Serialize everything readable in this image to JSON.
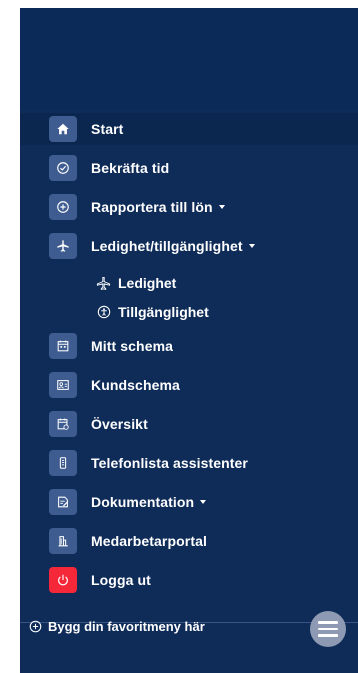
{
  "menu": {
    "items": [
      {
        "label": "Start",
        "icon": "home-icon"
      },
      {
        "label": "Bekräfta tid",
        "icon": "check-circle-icon"
      },
      {
        "label": "Rapportera till lön",
        "icon": "plus-circle-icon",
        "dropdown": true
      },
      {
        "label": "Ledighet/tillgänglighet",
        "icon": "airplane-icon",
        "dropdown": true
      },
      {
        "label": "Mitt schema",
        "icon": "calendar-icon"
      },
      {
        "label": "Kundschema",
        "icon": "customer-schedule-icon"
      },
      {
        "label": "Översikt",
        "icon": "overview-calendar-icon"
      },
      {
        "label": "Telefonlista assistenter",
        "icon": "phone-list-icon"
      },
      {
        "label": "Dokumentation",
        "icon": "document-edit-icon",
        "dropdown": true
      },
      {
        "label": "Medarbetarportal",
        "icon": "portal-icon"
      },
      {
        "label": "Logga ut",
        "icon": "power-icon"
      }
    ],
    "subitems": [
      {
        "label": "Ledighet",
        "icon": "airplane-icon"
      },
      {
        "label": "Tillgänglighet",
        "icon": "accessibility-icon"
      }
    ]
  },
  "footer": {
    "favorites_label": "Bygg din favoritmeny här",
    "menu_icon": "hamburger-menu-icon"
  },
  "colors": {
    "sidebar_bg": "#0f2c59",
    "icon_bg": "#3e5c90",
    "logout_bg": "#f5283a",
    "text": "#ffffff"
  }
}
